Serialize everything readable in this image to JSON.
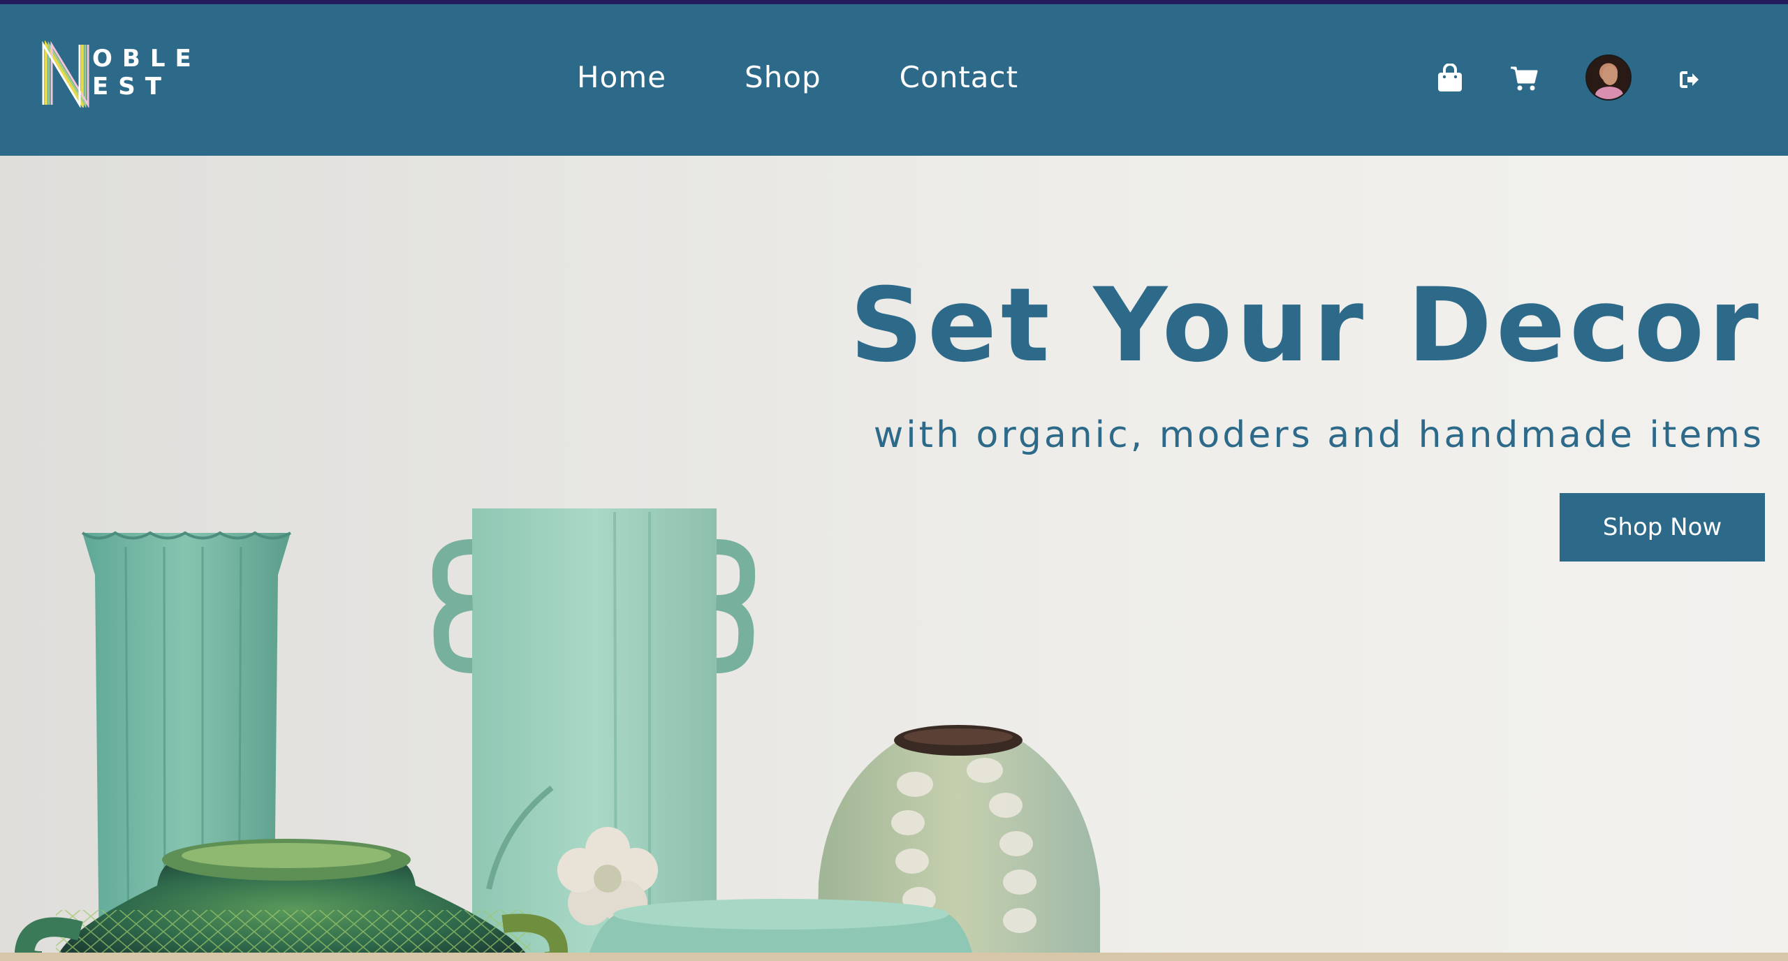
{
  "brand": {
    "logo_line1": "OBLE",
    "logo_line2": "EST",
    "logo_letter": "N"
  },
  "nav": {
    "links": [
      {
        "label": "Home"
      },
      {
        "label": "Shop"
      },
      {
        "label": "Contact"
      }
    ],
    "icons": [
      "shopping-bag-icon",
      "cart-icon",
      "user-avatar",
      "logout-icon"
    ]
  },
  "hero": {
    "title": "Set Your Decor",
    "subtitle": "with organic, moders and handmade items",
    "cta_label": "Shop Now"
  },
  "colors": {
    "primary": "#2d6a8a",
    "topline": "#241a5c",
    "background": "#ecebe8"
  }
}
